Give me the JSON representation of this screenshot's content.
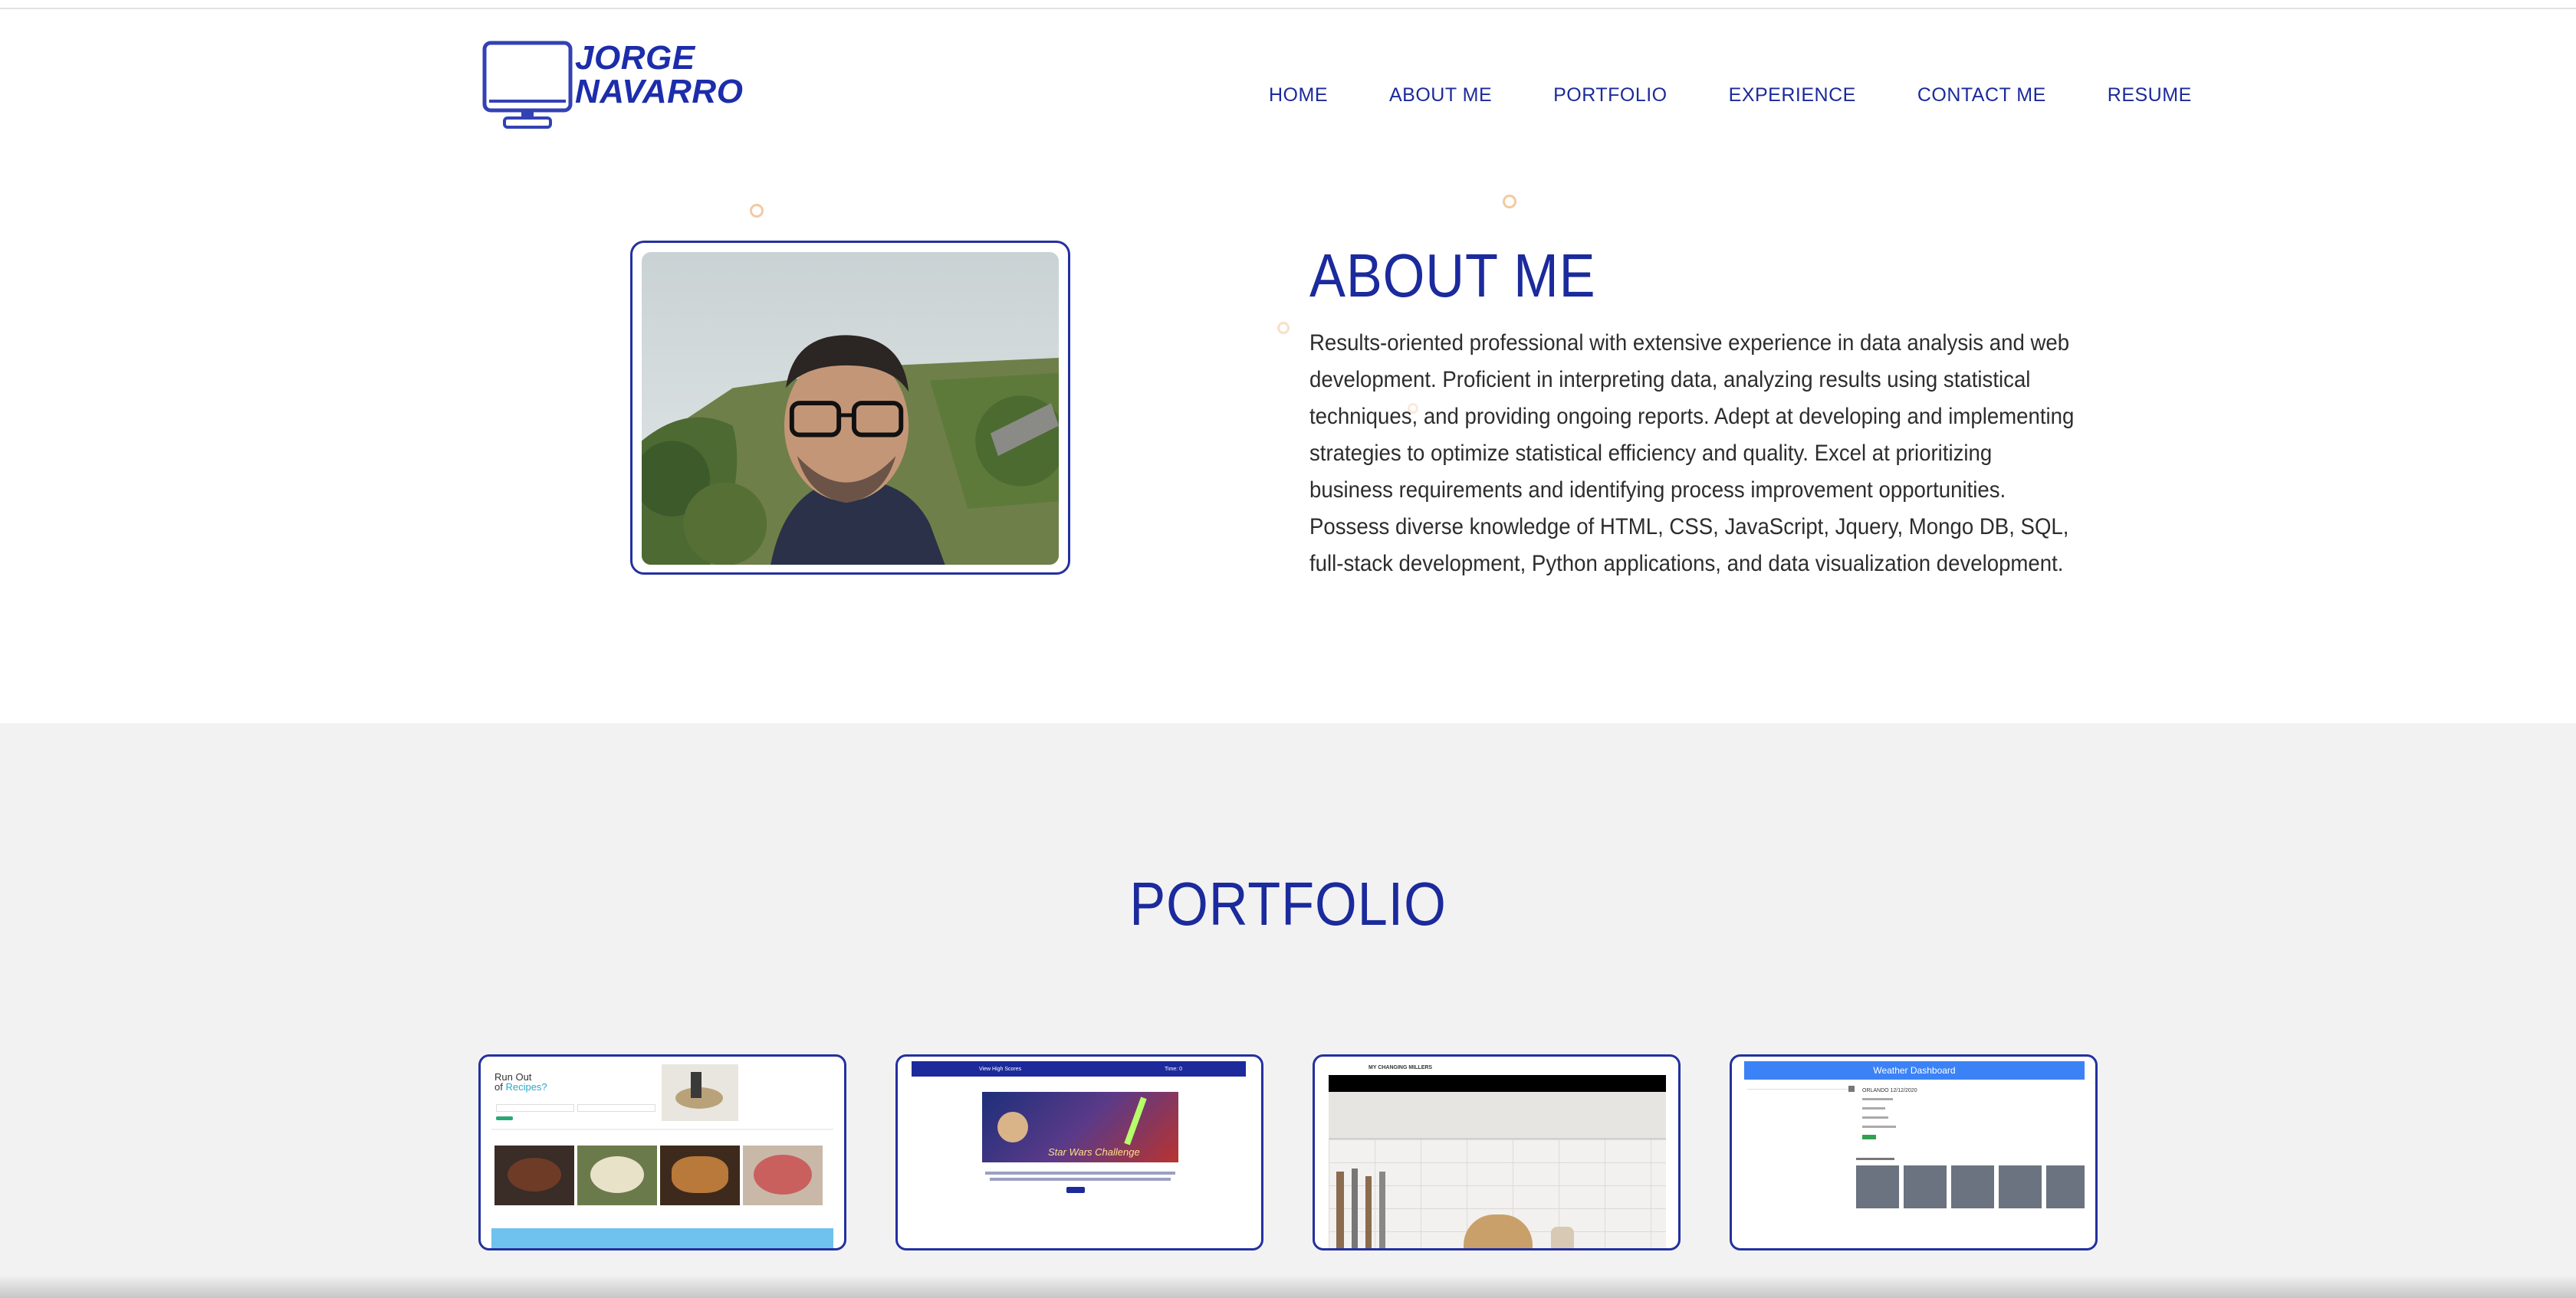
{
  "header": {
    "logo_line1": "JORGE",
    "logo_line2": "NAVARRO",
    "nav": [
      "HOME",
      "ABOUT ME",
      "PORTFOLIO",
      "EXPERIENCE",
      "CONTACT ME",
      "RESUME"
    ]
  },
  "about": {
    "title": "ABOUT ME",
    "text": "Results-oriented professional with extensive experience in data analysis and web development. Proficient in interpreting data, analyzing results using statistical techniques, and providing ongoing reports. Adept at developing and implementing strategies to optimize statistical efficiency and quality. Excel at prioritizing business requirements and identifying process improvement opportunities. Possess diverse knowledge of HTML, CSS, JavaScript, Jquery, Mongo DB, SQL, full-stack development, Python applications, and data visualization development."
  },
  "portfolio": {
    "title": "PORTFOLIO",
    "cards": [
      {
        "headline_1": "Run Out",
        "headline_2": "of ",
        "headline_accent": "Recipes?"
      },
      {
        "banner_left": "View High Scores",
        "banner_right": "Time: 0",
        "image_title": "Star Wars Challenge"
      },
      {
        "brand": "MY CHANGING MILLERS"
      },
      {
        "title": "Weather Dashboard",
        "city": "ORLANDO 12/12/2020"
      }
    ]
  },
  "colors": {
    "brand_blue": "#1b2a9c",
    "portfolio_bg": "#f2f2f2",
    "deco_orange": "#f3c9a2",
    "weather_blue": "#3b82f6"
  }
}
